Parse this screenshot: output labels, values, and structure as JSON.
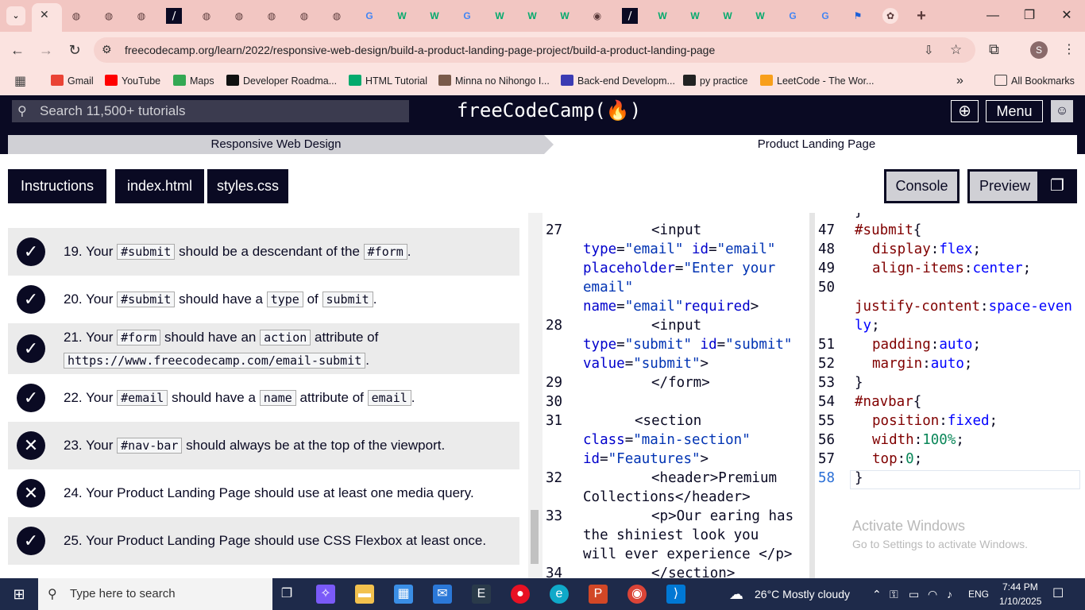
{
  "browser": {
    "url": "freecodecamp.org/learn/2022/responsive-web-design/build-a-product-landing-page-project/build-a-product-landing-page",
    "tab_icons": [
      "wiki",
      "W",
      "G",
      "fcc",
      "flag",
      "chrome"
    ],
    "bookmarks": [
      "Gmail",
      "YouTube",
      "Maps",
      "Developer Roadma...",
      "HTML Tutorial",
      "Minna no Nihongo I...",
      "Back-end Developm...",
      "py practice",
      "LeetCode - The Wor..."
    ],
    "all_bookmarks": "All Bookmarks",
    "more": "»",
    "profile_initial": "S"
  },
  "fcc": {
    "search_placeholder": "Search 11,500+ tutorials",
    "logo": "freeCodeCamp(🔥)",
    "menu": "Menu"
  },
  "breadcrumb": {
    "course": "Responsive Web Design",
    "project": "Product Landing Page"
  },
  "tabs": {
    "instructions": "Instructions",
    "index": "index.html",
    "styles": "styles.css",
    "console": "Console",
    "preview": "Preview"
  },
  "tests": [
    {
      "pass": true,
      "num": "19.",
      "pre": "Your",
      "c1": "#submit",
      "mid": "should be a descendant of the",
      "c2": "#form",
      "post": "."
    },
    {
      "pass": true,
      "num": "20.",
      "pre": "Your",
      "c1": "#submit",
      "mid": "should have a",
      "c2": "type",
      "mid2": "of",
      "c3": "submit",
      "post": "."
    },
    {
      "pass": true,
      "num": "21.",
      "pre": "Your",
      "c1": "#form",
      "mid": "should have an",
      "c2": "action",
      "mid2": "attribute of",
      "c3": "https://www.freecodecamp.com/email-submit",
      "post": "."
    },
    {
      "pass": true,
      "num": "22.",
      "pre": "Your",
      "c1": "#email",
      "mid": "should have a",
      "c2": "name",
      "mid2": "attribute of",
      "c3": "email",
      "post": "."
    },
    {
      "pass": false,
      "num": "23.",
      "pre": "Your",
      "c1": "#nav-bar",
      "mid": "should always be at the top of the viewport."
    },
    {
      "pass": false,
      "num": "24.",
      "text": "Your Product Landing Page should use at least one media query."
    },
    {
      "pass": true,
      "num": "25.",
      "text": "Your Product Landing Page should use CSS Flexbox at least once."
    }
  ],
  "watermark": {
    "line1": "Activate Windows",
    "line2": "Go to Settings to activate Windows."
  },
  "taskbar": {
    "search": "Type here to search",
    "weather": "26°C  Mostly cloudy",
    "lang": "ENG",
    "time": "7:44 PM",
    "date": "1/10/2025"
  }
}
